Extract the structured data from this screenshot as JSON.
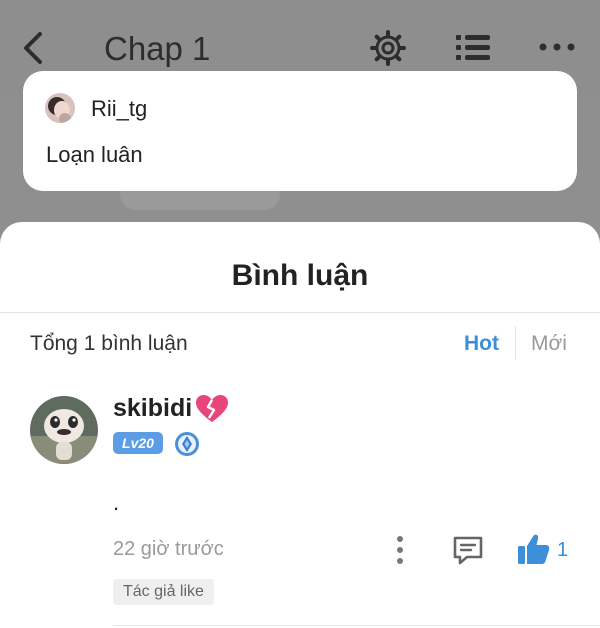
{
  "header": {
    "title": "Chap 1",
    "icons": [
      "back-icon",
      "gear-icon",
      "list-icon",
      "more-icon"
    ]
  },
  "popup_comment": {
    "username": "Rii_tg",
    "text": "Loạn luân"
  },
  "comments_panel": {
    "heading": "Bình luận",
    "total_label": "Tổng 1 bình luận",
    "tabs": [
      {
        "label": "Hot",
        "active": true
      },
      {
        "label": "Mới",
        "active": false
      }
    ]
  },
  "comments": [
    {
      "username": "skibidi",
      "name_emoji_icon": "broken-heart-icon",
      "level": "Lv20",
      "badge_icon": "diamond-badge-icon",
      "text": ".",
      "time": "22 giờ trước",
      "like_count": "1",
      "author_like_label": "Tác giả like"
    }
  ],
  "colors": {
    "accent": "#3d8fd9",
    "level_badge": "#5b9ee6",
    "heart": "#e8457a",
    "overlay": "#8e8e8e"
  }
}
